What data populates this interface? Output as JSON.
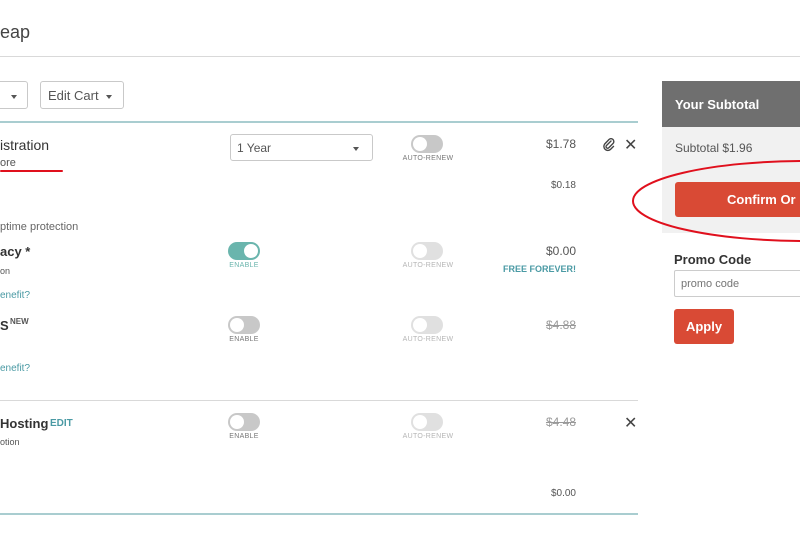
{
  "header": {
    "title_fragment": "eap"
  },
  "toolbar": {
    "first_button_label": "",
    "edit_cart_label": "Edit Cart"
  },
  "items": {
    "domain": {
      "title_fragment": "istration",
      "subtitle_fragment": "ore",
      "term_select_value": "1 Year",
      "auto_renew_label": "AUTO-RENEW",
      "price": "$1.78",
      "subprice": "$0.18"
    },
    "uptime_label": "ptime protection",
    "privacy": {
      "title_fragment": "acy *",
      "subtitle_fragment": "on",
      "link_fragment": "enefit?",
      "enable_label": "ENABLE",
      "auto_renew_label": "AUTO-RENEW",
      "price": "$0.00",
      "badge": "FREE FOREVER!"
    },
    "dns": {
      "title_fragment": "S",
      "new_badge": "NEW",
      "link_fragment": "enefit?",
      "enable_label": "ENABLE",
      "auto_renew_label": "AUTO-RENEW",
      "price": "$4.88"
    },
    "hosting": {
      "title_fragment": "Hosting",
      "edit_label": "EDIT",
      "subtitle_fragment": "otion",
      "enable_label": "ENABLE",
      "auto_renew_label": "AUTO-RENEW",
      "price": "$4.48",
      "subprice": "$0.00"
    }
  },
  "sidebar": {
    "header": "Your Subtotal",
    "subtotal": "Subtotal $1.96",
    "confirm_label": "Confirm Or",
    "promo_title": "Promo Code",
    "promo_placeholder": "promo code",
    "apply_label": "Apply"
  },
  "colors": {
    "teal": "#6ab5ad",
    "confirm": "#d94a35",
    "annotation_red": "#e0101d",
    "sidebar_header_bg": "#6f6f6f"
  }
}
